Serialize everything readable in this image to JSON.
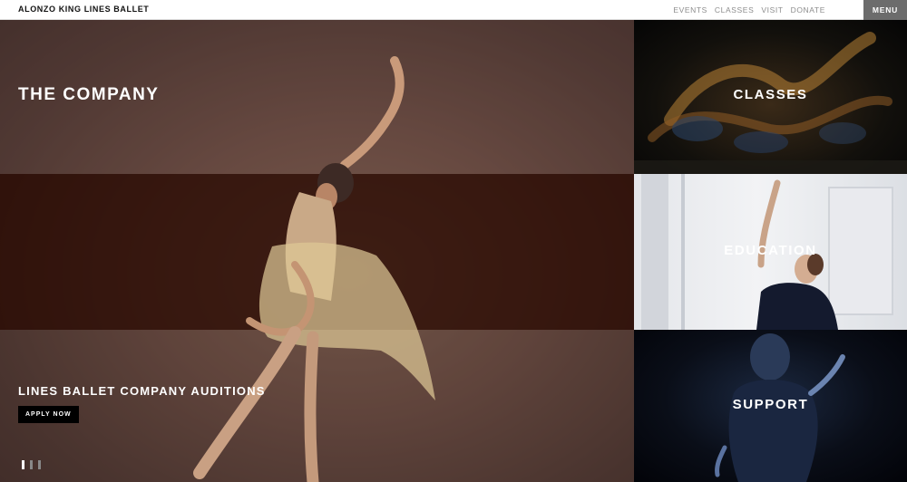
{
  "header": {
    "brand": "ALONZO KING LINES BALLET",
    "nav": [
      "EVENTS",
      "CLASSES",
      "VISIT",
      "DONATE"
    ],
    "menu_label": "MENU"
  },
  "hero": {
    "title": "THE COMPANY",
    "audition_title": "LINES BALLET COMPANY AUDITIONS",
    "apply_label": "APPLY NOW",
    "slide_count": 3,
    "active_slide": 1
  },
  "tiles": [
    {
      "label": "CLASSES"
    },
    {
      "label": "EDUCATION"
    },
    {
      "label": "SUPPORT"
    }
  ],
  "colors": {
    "band_dark": "#280800",
    "menu_bg": "#6c6c6c",
    "nav_text": "#8d8d8d"
  }
}
